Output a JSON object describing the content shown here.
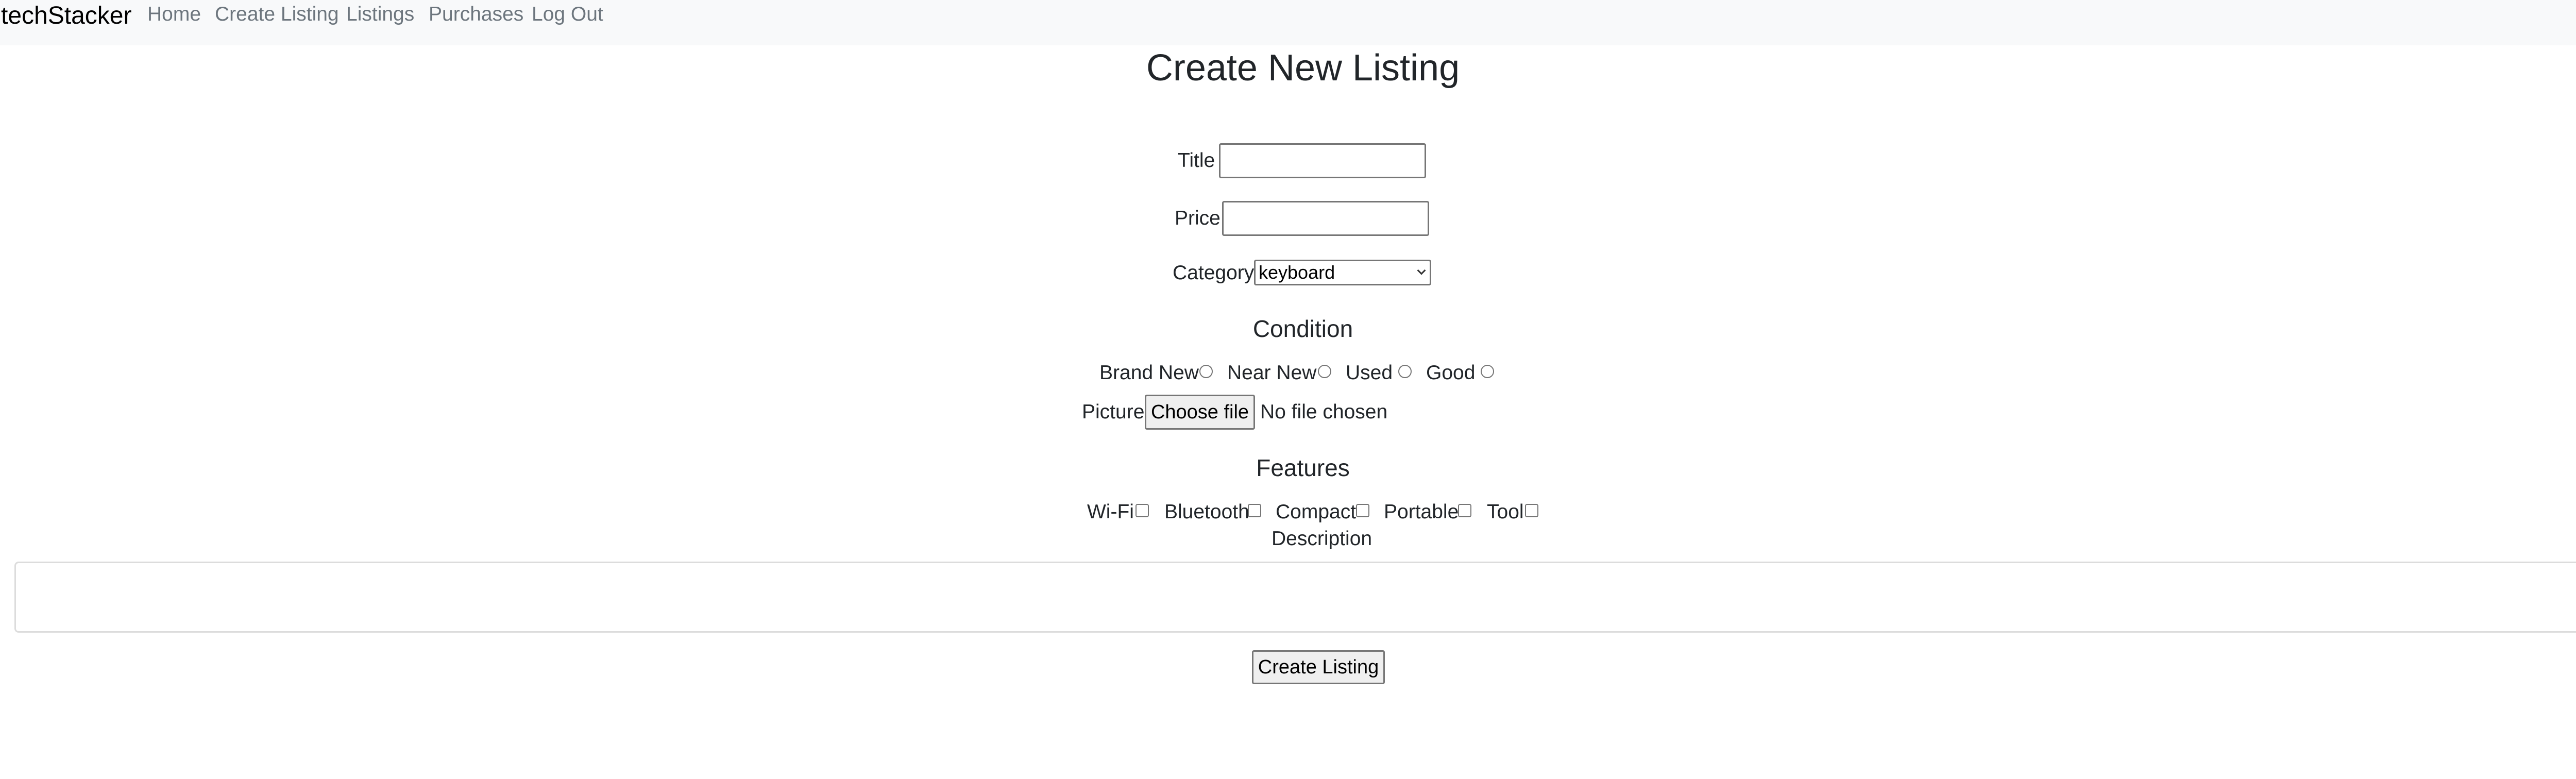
{
  "navbar": {
    "brand": "techStacker",
    "links": [
      "Home",
      "Create Listing",
      "Listings",
      "Purchases",
      "Log Out"
    ]
  },
  "page": {
    "title": "Create New Listing"
  },
  "form": {
    "title_label": "Title",
    "title_value": "",
    "price_label": "Price",
    "price_value": "",
    "category_label": "Category",
    "category_selected": "keyboard",
    "condition_heading": "Condition",
    "conditions": [
      "Brand New",
      "Near New",
      "Used",
      "Good"
    ],
    "picture_label": "Picture",
    "choose_file_label": "Choose file",
    "no_file_text": "No file chosen",
    "features_heading": "Features",
    "features": [
      "Wi-Fi",
      "Bluetooth",
      "Compact",
      "Portable",
      "Tool"
    ],
    "description_label": "Description",
    "description_value": "",
    "submit_label": "Create Listing"
  },
  "colors": {
    "navbar_bg": "#f8f9fa",
    "nav_link": "#6c757d",
    "text": "#212529"
  }
}
